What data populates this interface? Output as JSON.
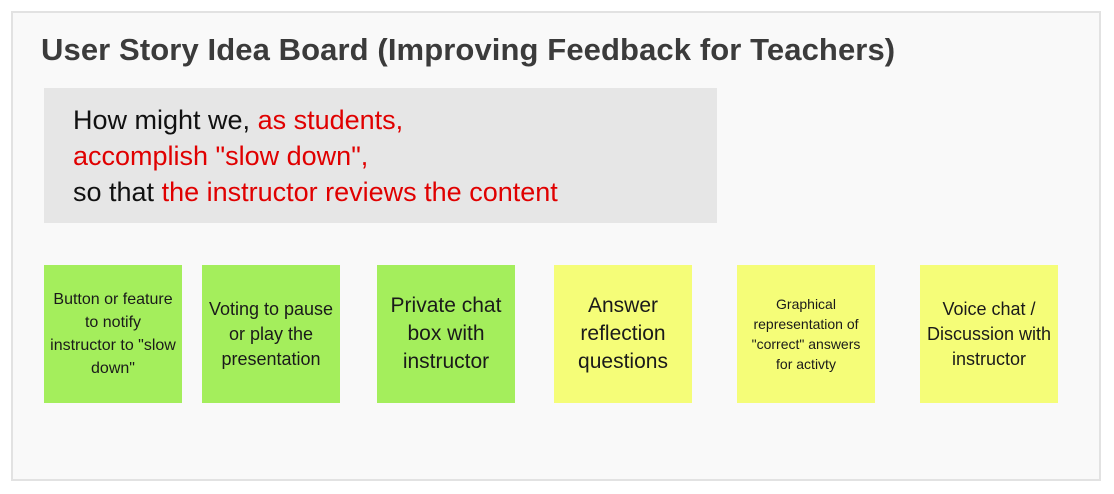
{
  "title": "User Story Idea Board (Improving Feedback for Teachers)",
  "prompt": {
    "prefix1": "How might we, ",
    "who": "as students,",
    "what": "accomplish \"slow down\",",
    "prefix3": "so that ",
    "goal": "the instructor reviews the content"
  },
  "notes": [
    {
      "text": "Button or feature to notify instructor to \"slow down\"",
      "color": "#a4ee5c"
    },
    {
      "text": "Voting to pause or play the presentation",
      "color": "#a4ee5c"
    },
    {
      "text": "Private chat box with instructor",
      "color": "#a4ee5c"
    },
    {
      "text": "Answer reflection questions",
      "color": "#f5fd78"
    },
    {
      "text": "Graphical representation of \"correct\" answers for activty",
      "color": "#f5fd78"
    },
    {
      "text": "Voice chat / Discussion with instructor",
      "color": "#f5fd78"
    }
  ],
  "colors": {
    "accent_text": "#e00000",
    "green_note": "#a4ee5c",
    "yellow_note": "#f5fd78"
  }
}
